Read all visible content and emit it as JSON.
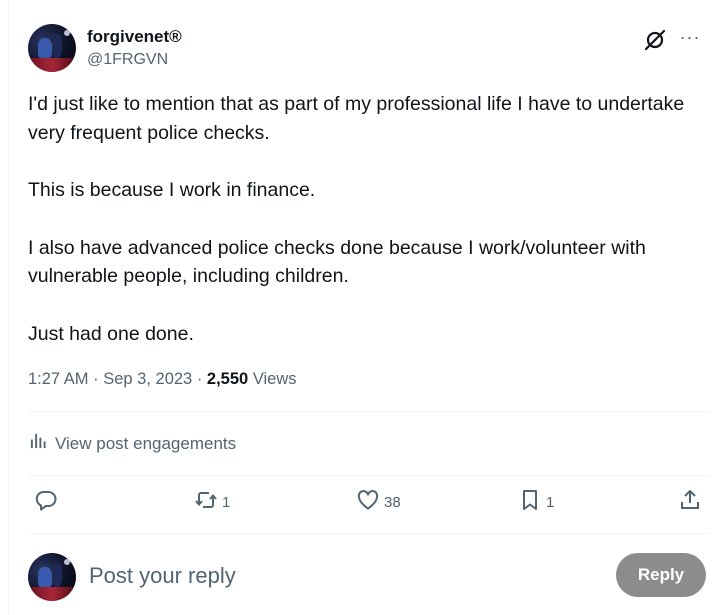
{
  "author": {
    "display_name": "forgivenet®",
    "handle": "@1FRGVN"
  },
  "post": {
    "paragraphs": [
      "I'd just like to mention that as part of my professional life I have to undertake very frequent police checks.",
      "This is because I work in finance.",
      "I also have advanced police checks done because I work/volunteer with vulnerable people, including children.",
      "Just had one done."
    ],
    "time": "1:27 AM",
    "date": "Sep 3, 2023",
    "views_count": "2,550",
    "views_label": "Views"
  },
  "engagements_link": "View post engagements",
  "actions": {
    "reply_count": "",
    "repost_count": "1",
    "like_count": "38",
    "bookmark_count": "1"
  },
  "reply_box": {
    "placeholder": "Post your reply",
    "button_label": "Reply"
  },
  "icons": [
    "grok-icon",
    "more-icon",
    "analytics-icon",
    "reply-icon",
    "repost-icon",
    "like-icon",
    "bookmark-icon",
    "share-icon"
  ],
  "colors": {
    "text": "#0f1419",
    "secondary": "#536471",
    "divider": "#eff3f4",
    "reply_button": "#8c8c8c"
  }
}
